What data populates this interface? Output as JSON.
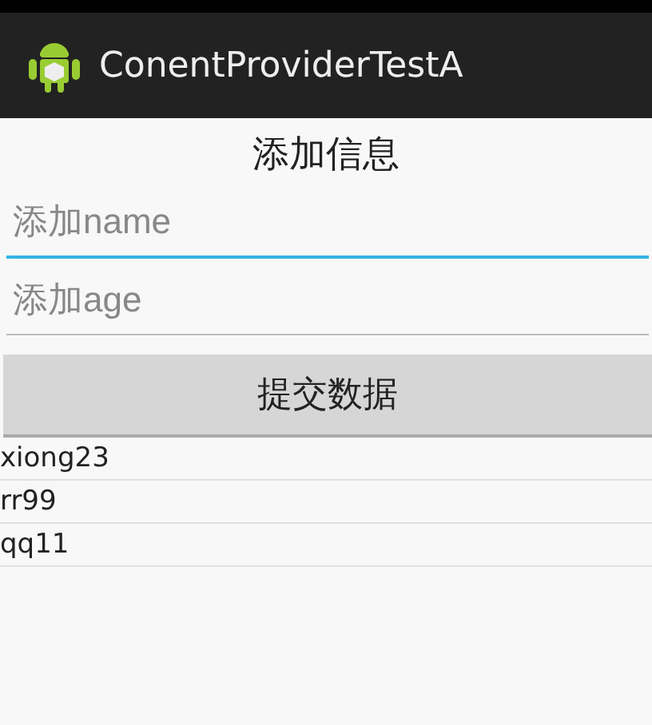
{
  "action_bar": {
    "title": "ConentProviderTestA"
  },
  "heading": "添加信息",
  "fields": [
    {
      "placeholder": "添加name",
      "focused": true
    },
    {
      "placeholder": "添加age",
      "focused": false
    }
  ],
  "submit_button": "提交数据",
  "list": [
    {
      "text": "xiong23"
    },
    {
      "text": "rr99"
    },
    {
      "text": "qq11"
    }
  ]
}
